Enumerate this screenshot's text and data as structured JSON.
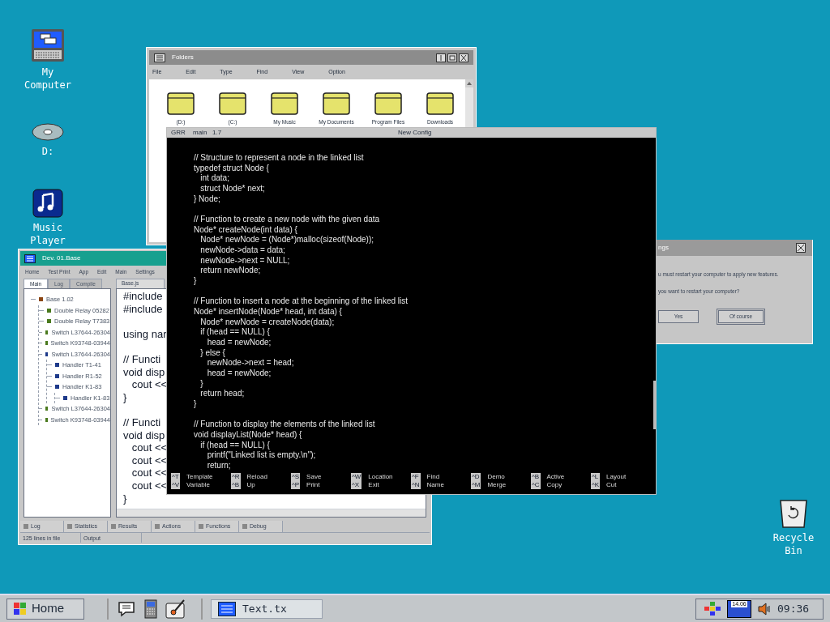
{
  "desktop_icons": [
    {
      "kind": "computer",
      "label": [
        "My",
        "Computer"
      ]
    },
    {
      "kind": "disc",
      "label": [
        "D:"
      ]
    },
    {
      "kind": "music",
      "label": [
        "Music",
        "Player"
      ]
    }
  ],
  "recycle_bin": {
    "label": [
      "Recycle",
      "Bin"
    ]
  },
  "folders_window": {
    "title": "Folders",
    "menu": [
      "File",
      "Edit",
      "Type",
      "Find",
      "View",
      "Option"
    ],
    "folders": [
      "(D:)",
      "(C:)",
      "My Music",
      "My Documents",
      "Program Files",
      "Downloads"
    ]
  },
  "dev_window": {
    "title": "Dev. 01.Base",
    "menu": [
      "Home",
      "Test Print",
      "App",
      "Edit",
      "Main",
      "Settings"
    ],
    "tabs": [
      {
        "label": "Main",
        "selected": true
      },
      {
        "label": "Log",
        "selected": false
      },
      {
        "label": "Compile",
        "selected": false
      }
    ],
    "tree": [
      {
        "label": "Base 1.02",
        "color": "#8b4513",
        "children": [
          {
            "label": "Double Relay 05282",
            "color": "#4a7a1e"
          },
          {
            "label": "Double Relay T7383",
            "color": "#4a7a1e"
          },
          {
            "label": "Switch L37644-26304",
            "color": "#4a7a1e"
          },
          {
            "label": "Switch K93748-03944",
            "color": "#4a7a1e"
          },
          {
            "label": "Switch L37644-26304",
            "color": "#1e3a8a",
            "children": [
              {
                "label": "Handler T1-41",
                "color": "#1e3a8a"
              },
              {
                "label": "Handler R1-52",
                "color": "#1e3a8a"
              },
              {
                "label": "Handler K1-83",
                "color": "#1e3a8a",
                "children": [
                  {
                    "label": "Handler K1-83",
                    "color": "#1e3a8a"
                  }
                ]
              }
            ]
          },
          {
            "label": "Switch L37644-26304",
            "color": "#4a7a1e"
          },
          {
            "label": "Switch K93748-03944",
            "color": "#4a7a1e"
          }
        ]
      }
    ],
    "editor_tab": "Base.js",
    "code": [
      [
        "#include",
        "#include"
      ],
      [
        "using nar"
      ],
      [
        "// Functi",
        "void disp",
        "   cout <<",
        "}"
      ],
      [
        "// Functi",
        "void disp",
        "   cout <<",
        "   cout <<",
        "   cout <<",
        "   cout <<",
        "}"
      ]
    ],
    "bottom_tabs": [
      "Log",
      "Statistics",
      "Results",
      "Actions",
      "Functions",
      "Debug"
    ],
    "status": [
      "125 lines in file",
      "Output"
    ]
  },
  "settings_dialog": {
    "title": "ngs",
    "lines": [
      "u must restart your computer to apply new features.",
      "you want to restart your computer?"
    ],
    "buttons": [
      "Yes",
      "Of course"
    ]
  },
  "terminal": {
    "header": [
      "GRR",
      "main",
      "1.7"
    ],
    "title": "New Config",
    "code": [
      [
        "// Structure to represent a node in the linked list",
        "typedef struct Node {",
        "   int data;",
        "   struct Node* next;",
        "} Node;"
      ],
      [
        "// Function to create a new node with the given data",
        "Node* createNode(int data) {",
        "   Node* newNode = (Node*)malloc(sizeof(Node));",
        "   newNode->data = data;",
        "   newNode->next = NULL;",
        "   return newNode;",
        "}"
      ],
      [
        "// Function to insert a node at the beginning of the linked list",
        "Node* insertNode(Node* head, int data) {",
        "   Node* newNode = createNode(data);",
        "   if (head == NULL) {",
        "      head = newNode;",
        "   } else {",
        "      newNode->next = head;",
        "      head = newNode;",
        "   }",
        "   return head;",
        "}"
      ],
      [
        "// Function to display the elements of the linked list",
        "void displayList(Node* head) {",
        "   if (head == NULL) {",
        "      printf(\"Linked list is empty.\\n\");",
        "      return;"
      ]
    ],
    "shortcuts": [
      [
        {
          "key": "^T",
          "label": "Template"
        },
        {
          "key": "^V",
          "label": "Variable"
        }
      ],
      [
        {
          "key": "^R",
          "label": "Reload"
        },
        {
          "key": "^B",
          "label": "Up"
        }
      ],
      [
        {
          "key": "^S",
          "label": "Save"
        },
        {
          "key": "^P",
          "label": "Print"
        }
      ],
      [
        {
          "key": "^W",
          "label": "Location"
        },
        {
          "key": "^X",
          "label": "Exit"
        }
      ],
      [
        {
          "key": "^F",
          "label": "Find"
        },
        {
          "key": "^N",
          "label": "Name"
        }
      ],
      [
        {
          "key": "^D",
          "label": "Demo"
        },
        {
          "key": "^M",
          "label": "Merge"
        }
      ],
      [
        {
          "key": "^B",
          "label": "Active"
        },
        {
          "key": "^C",
          "label": "Copy"
        }
      ],
      [
        {
          "key": "^L",
          "label": "Layout"
        },
        {
          "key": "^K",
          "label": "Cut"
        }
      ]
    ]
  },
  "taskbar": {
    "start": "Home",
    "task": "Text.tx",
    "calendar": "14.06",
    "clock": "09:36"
  }
}
